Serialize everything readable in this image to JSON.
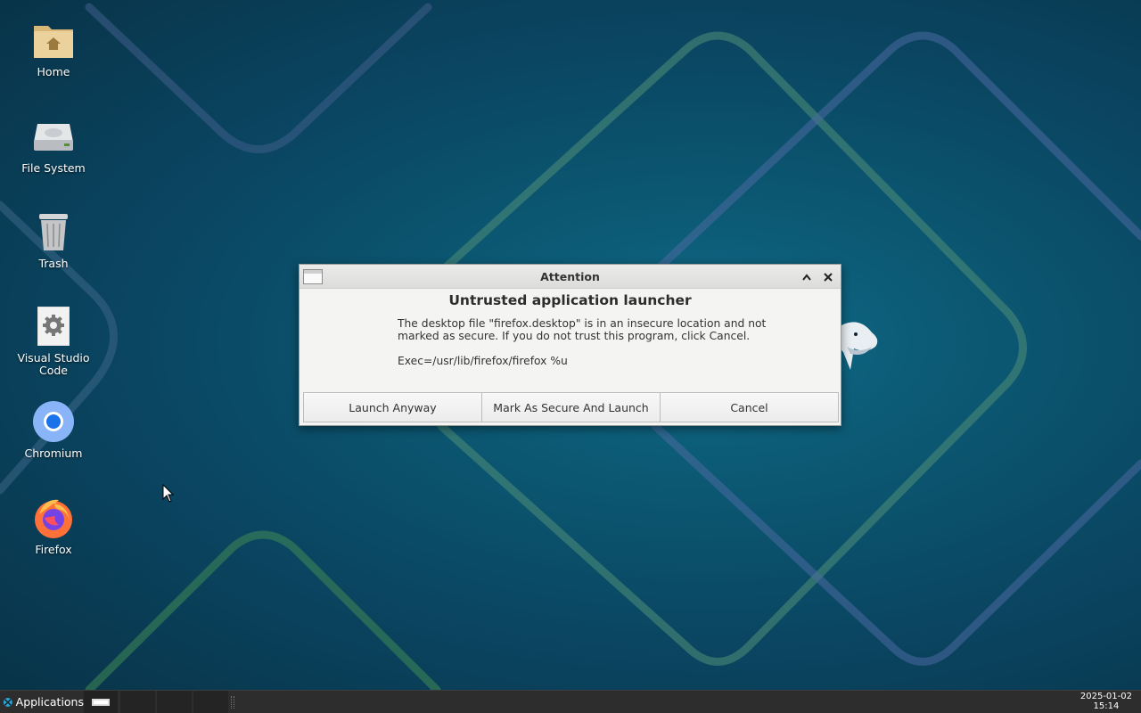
{
  "desktop": {
    "icons": [
      {
        "label": "Home",
        "icon": "home-folder-icon"
      },
      {
        "label": "File System",
        "icon": "drive-icon"
      },
      {
        "label": "Trash",
        "icon": "trash-icon"
      },
      {
        "label": "Visual Studio Code",
        "icon": "settings-gear-icon"
      },
      {
        "label": "Chromium",
        "icon": "chromium-icon"
      },
      {
        "label": "Firefox",
        "icon": "firefox-icon"
      }
    ]
  },
  "dialog": {
    "window_title": "Attention",
    "heading": "Untrusted application launcher",
    "message": "The desktop file \"firefox.desktop\" is in an insecure location and not marked as secure. If you do not trust this program, click Cancel.",
    "exec": "Exec=/usr/lib/firefox/firefox %u",
    "buttons": {
      "launch_anyway": "Launch Anyway",
      "mark_secure": "Mark As Secure And Launch",
      "cancel": "Cancel"
    },
    "titlebar_buttons": {
      "maximize": "^",
      "close": "✕"
    }
  },
  "taskbar": {
    "applications_label": "Applications",
    "clock_date": "2025-01-02",
    "clock_time": "15:14"
  },
  "colors": {
    "wallpaper": "#0a4a66",
    "taskbar": "#2d2d2d",
    "dialog_bg": "#f4f4f3"
  }
}
